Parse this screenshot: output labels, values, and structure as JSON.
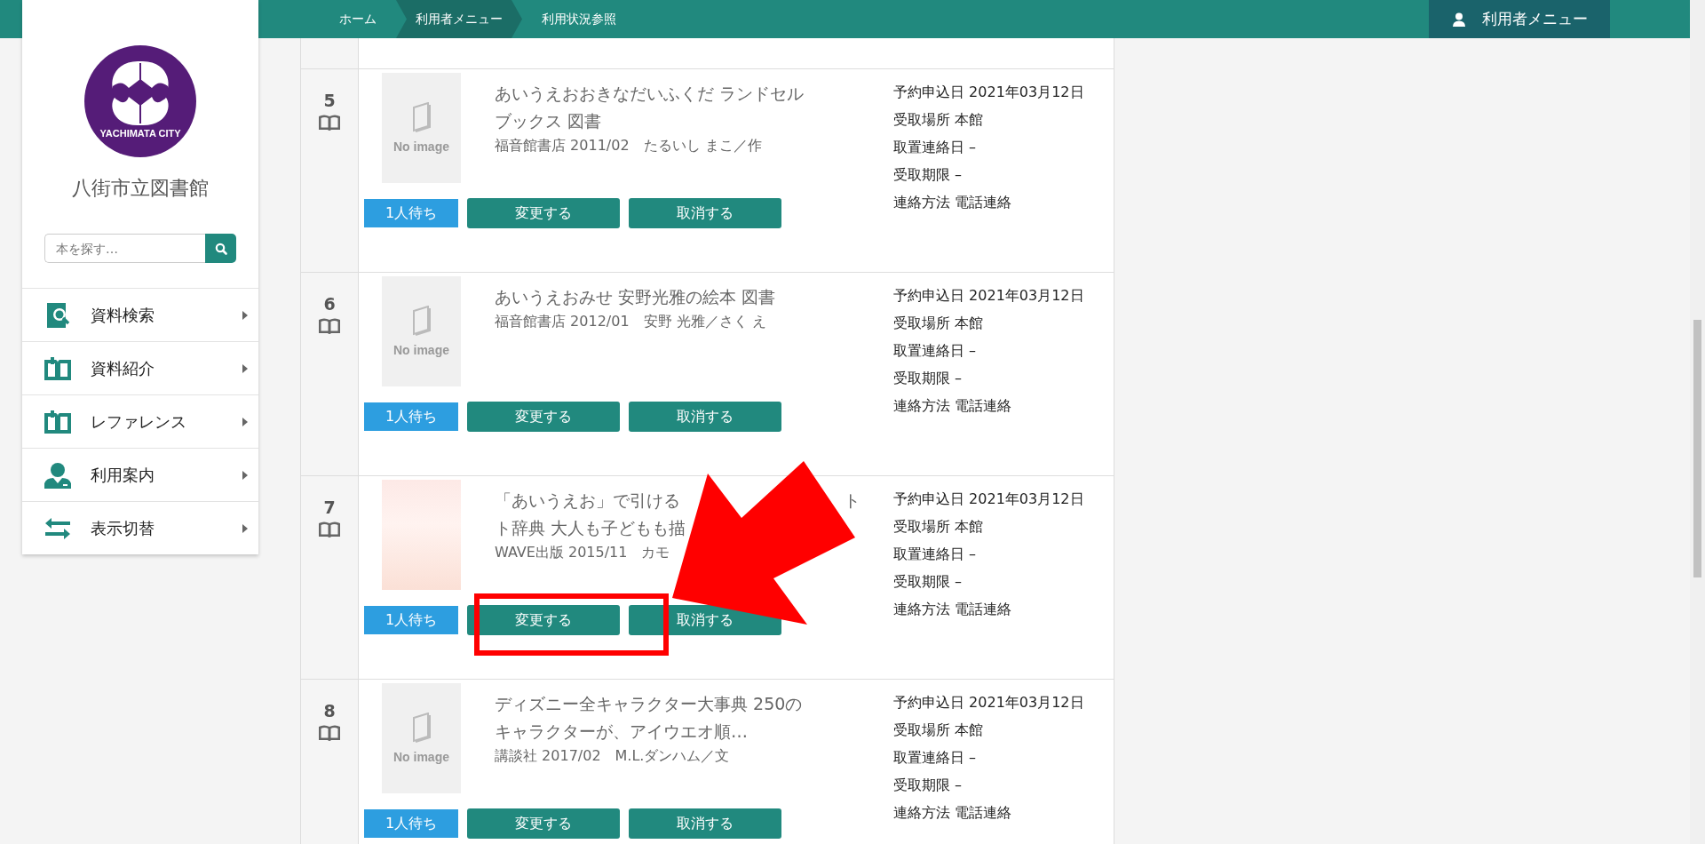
{
  "breadcrumb": [
    {
      "label": "ホーム",
      "selected": false
    },
    {
      "label": "利用者メニュー",
      "selected": true
    },
    {
      "label": "利用状況参照",
      "selected": false
    }
  ],
  "user_menu": {
    "label": "利用者メニュー"
  },
  "sidebar": {
    "logo_text": "YACHIMATA CITY",
    "library_name": "八街市立図書館",
    "search": {
      "placeholder": "本を探す…"
    },
    "items": [
      {
        "label": "資料検索",
        "kind": "search"
      },
      {
        "label": "資料紹介",
        "kind": "book"
      },
      {
        "label": "レファレンス",
        "kind": "book"
      },
      {
        "label": "利用案内",
        "kind": "person"
      },
      {
        "label": "表示切替",
        "kind": "swap"
      }
    ]
  },
  "reservations": [
    {
      "number": "5",
      "kind": "placeholder",
      "cover_label": "No image",
      "title_lines": [
        [
          "あいうえおおきなだいふくだ ランドセル"
        ],
        [
          "ブックス 図書"
        ]
      ],
      "meta": [
        "福音館書店 2011/02　たるいし まこ／作"
      ],
      "queue": "1人待ち",
      "change": "変更する",
      "cancel": "取消する",
      "highlighted": false,
      "details": [
        "予約申込日 2021年03月12日",
        "受取場所 本館",
        "取置連絡日 –",
        "受取期限 –",
        "連絡方法 電話連絡"
      ]
    },
    {
      "number": "6",
      "kind": "placeholder",
      "cover_label": "No image",
      "title_lines": [
        [
          "あいうえおみせ 安野光雅の絵本 図書"
        ]
      ],
      "meta": [
        "福音館書店 2012/01　安野 光雅／さく え"
      ],
      "queue": "1人待ち",
      "change": "変更する",
      "cancel": "取消する",
      "highlighted": false,
      "details": [
        "予約申込日 2021年03月12日",
        "受取場所 本館",
        "取置連絡日 –",
        "受取期限 –",
        "連絡方法 電話連絡"
      ]
    },
    {
      "number": "7",
      "kind": "photo",
      "title_lines": [
        [
          "「あいうえお」で引ける",
          "ト"
        ],
        [
          "ト辞典 大人も子どもも描"
        ]
      ],
      "meta": [
        "WAVE出版 2015/11　カモ"
      ],
      "queue": "1人待ち",
      "change": "変更する",
      "cancel": "取消する",
      "highlighted": true,
      "details": [
        "予約申込日 2021年03月12日",
        "受取場所 本館",
        "取置連絡日 –",
        "受取期限 –",
        "連絡方法 電話連絡"
      ]
    },
    {
      "number": "8",
      "kind": "placeholder",
      "cover_label": "No image",
      "title_lines": [
        [
          "ディズニー全キャラクター大事典 250の"
        ],
        [
          "キャラクターが、アイウエオ順…"
        ]
      ],
      "meta": [
        "講談社 2017/02　M.L.ダンハム／文"
      ],
      "queue": "1人待ち",
      "change": "変更する",
      "cancel": "取消する",
      "highlighted": false,
      "details": [
        "予約申込日 2021年03月12日",
        "受取場所 本館",
        "取置連絡日 –",
        "受取期限 –",
        "連絡方法 電話連絡"
      ]
    }
  ]
}
